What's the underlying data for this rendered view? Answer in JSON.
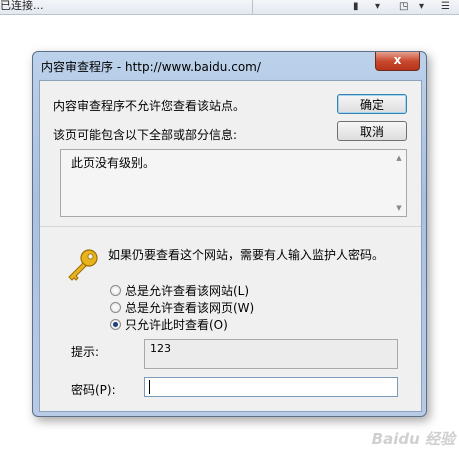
{
  "background": {
    "status_text": "已连接...",
    "tool_glyphs": [
      "▮",
      "▾",
      "◳",
      "▾",
      "☰"
    ]
  },
  "dialog": {
    "title": "内容审查程序 - http://www.baidu.com/",
    "close_glyph": "x",
    "message": "内容审查程序不允许您查看该站点。",
    "info_heading": "该页可能包含以下全部或部分信息:",
    "info_text": "此页没有级别。",
    "ok_label": "确定",
    "cancel_label": "取消",
    "prompt": "如果仍要查看这个网站，需要有人输入监护人密码。",
    "options": [
      {
        "label": "总是允许查看该网站(L)",
        "checked": false
      },
      {
        "label": "总是允许查看该网页(W)",
        "checked": false
      },
      {
        "label": "只允许此时查看(O)",
        "checked": true
      }
    ],
    "hint_label": "提示:",
    "hint_value": "123",
    "password_label": "密码(P):",
    "password_value": ""
  },
  "watermark": "Baidu 经验",
  "colors": {
    "title_bar": "#b4cae6",
    "close_button": "#c84a2e",
    "client_bg": "#f0f0f0",
    "key_icon": "#e8b31c"
  }
}
